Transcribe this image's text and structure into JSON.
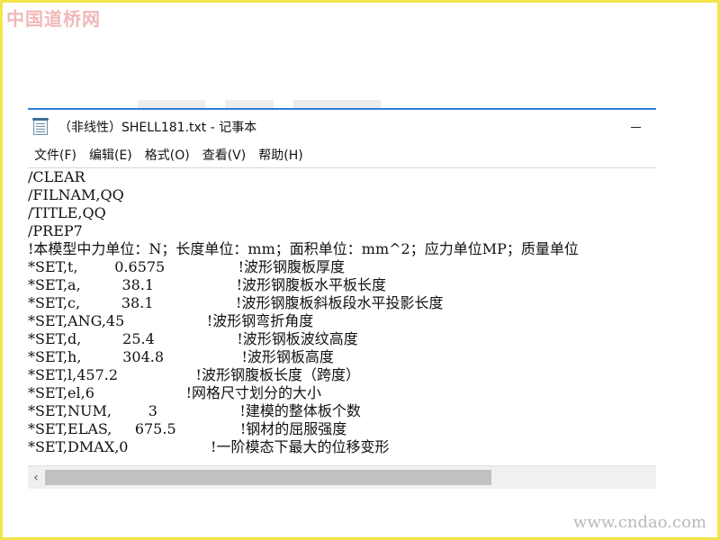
{
  "watermark": {
    "top": "中国道桥网",
    "bottom": "www.cndao.com"
  },
  "window": {
    "title": "（非线性）SHELL181.txt - 记事本",
    "icon": "notepad-icon",
    "controls": {
      "minimize": "minimize-icon",
      "close": "×"
    }
  },
  "menu": [
    "文件(F)",
    "编辑(E)",
    "格式(O)",
    "查看(V)",
    "帮助(H)"
  ],
  "editor": {
    "lines": [
      "/CLEAR",
      "/FILNAM,QQ",
      "/TITLE,QQ",
      "/PREP7",
      "!本模型中力单位：N；长度单位：mm；面积单位：mm^2；应力单位MP；质量单位",
      "*SET,t,        0.6575                !波形钢腹板厚度",
      "*SET,a,         38.1                  !波形钢腹板水平板长度",
      "*SET,c,         38.1                  !波形钢腹板斜板段水平投影长度",
      "*SET,ANG,45                  !波形钢弯折角度",
      "*SET,d,         25.4                  !波形钢板波纹高度",
      "*SET,h,         304.8                 !波形钢板高度",
      "*SET,l,457.2                 !波形钢腹板长度（跨度）",
      "*SET,el,6                    !网格尺寸划分的大小",
      "*SET,NUM,        3                  !建模的整体板个数",
      "*SET,ELAS,     675.5              !钢材的屈服强度",
      "*SET,DMAX,0                  !一阶模态下最大的位移变形"
    ]
  },
  "scrollbar": {
    "left_arrow": "‹"
  }
}
